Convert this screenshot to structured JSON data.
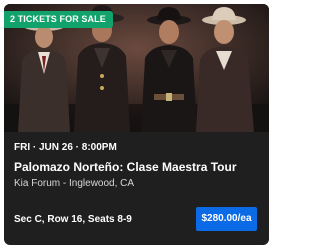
{
  "event_card": {
    "badge": "2 TICKETS FOR SALE",
    "date": "FRI · JUN 26 · 8:00PM",
    "title": "Palomazo Norteño: Clase Maestra Tour",
    "venue": "Kia Forum - Inglewood, CA",
    "seats": "Sec C, Row 16, Seats 8-9",
    "price": "$280.00/ea"
  },
  "colors": {
    "card_background": "#1f1f1f",
    "badge": "#12a36c",
    "price_button": "#0b6be6"
  },
  "icons": [
    "event-photo"
  ]
}
